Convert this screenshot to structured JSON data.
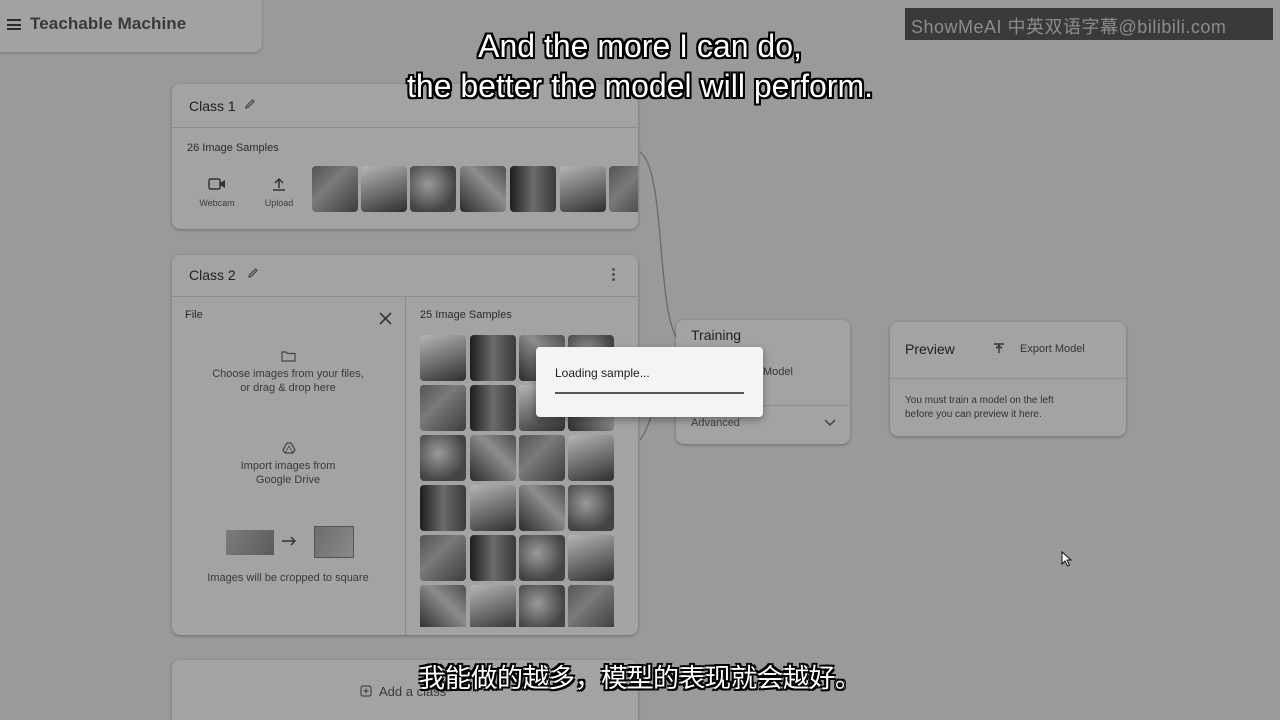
{
  "app": {
    "title": "Teachable Machine"
  },
  "watermark": "ShowMeAI 中英双语字幕@bilibili.com",
  "class1": {
    "name": "Class 1",
    "samples_label": "26 Image Samples",
    "webcam_label": "Webcam",
    "upload_label": "Upload"
  },
  "class2": {
    "name": "Class 2",
    "file_label": "File",
    "choose_files": "Choose images from your files,",
    "drag_drop": "or drag & drop here",
    "import_drive_1": "Import images from",
    "import_drive_2": "Google Drive",
    "crop_note": "Images will be cropped to square",
    "samples_label": "25 Image Samples"
  },
  "add_class_label": "Add a class",
  "training": {
    "title": "Training",
    "train_button": "Model",
    "advanced_label": "Advanced"
  },
  "preview": {
    "title": "Preview",
    "export_label": "Export Model",
    "message_1": "You must train a model on the left",
    "message_2": "before you can preview it here."
  },
  "dialog": {
    "text": "Loading sample..."
  },
  "subtitles": {
    "en_line1": "And the more I can do,",
    "en_line2": "the better the model will perform.",
    "zh": "我能做的越多，模型的表现就会越好。"
  }
}
